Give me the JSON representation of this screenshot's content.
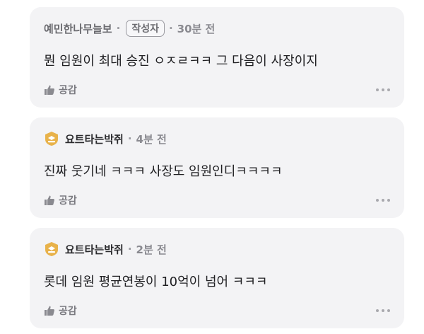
{
  "comments": [
    {
      "author": "예민한나무늘보",
      "badge": "작성자",
      "time": "30분 전",
      "text": "뭔 임원이 최대 승진 ㅇㅈㄹㅋㅋ 그 다음이 사장이지",
      "like_label": "공감",
      "has_level_icon": false
    },
    {
      "author": "요트타는박쥐",
      "badge": "",
      "time": "4분 전",
      "text": "진짜 웃기네 ㅋㅋㅋ 사장도 임원인디ㅋㅋㅋㅋ",
      "like_label": "공감",
      "has_level_icon": true
    },
    {
      "author": "요트타는박쥐",
      "badge": "",
      "time": "2분 전",
      "text": "롯데 임원 평균연봉이 10억이 넘어 ㅋㅋㅋ",
      "like_label": "공감",
      "has_level_icon": true
    }
  ],
  "icons": {
    "like": "thumbs-up-icon",
    "more": "more-options-icon",
    "level": "level-badge-icon"
  },
  "colors": {
    "card_bg": "#f3f3f5",
    "level_gold": "#e8b24a"
  }
}
